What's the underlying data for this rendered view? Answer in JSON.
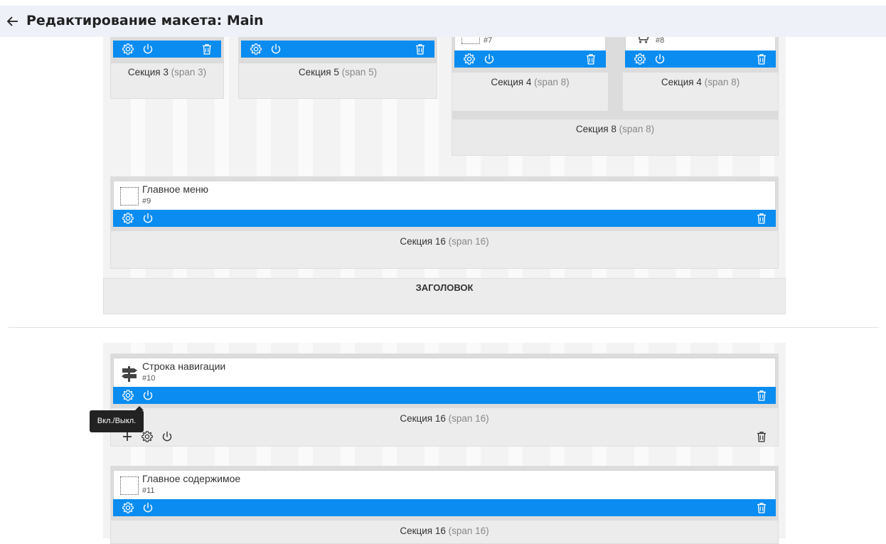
{
  "header": {
    "title": "Редактирование макета: Main"
  },
  "section_word": "Секция",
  "layout_top": {
    "sections": [
      {
        "name": "Секция 3",
        "span": "(span 3)"
      },
      {
        "name": "Секция 5",
        "span": "(span 5)"
      },
      {
        "name": "Секция 4",
        "span": "(span 8)"
      },
      {
        "name": "Секция 4",
        "span": "(span 8)"
      },
      {
        "name": "Секция 8",
        "span": "(span 8)"
      }
    ],
    "modules": [
      {
        "number": "#7",
        "icon": "placeholder-icon"
      },
      {
        "number": "#8",
        "icon": "cart-icon"
      }
    ],
    "menu_row": {
      "module": {
        "title": "Главное меню",
        "number": "#9",
        "icon": "placeholder-icon"
      },
      "section": {
        "name": "Секция 16",
        "span": "(span 16)"
      }
    },
    "header_label": "ЗАГОЛОВОК"
  },
  "layout_bottom": {
    "nav_row": {
      "module": {
        "title": "Строка навигации",
        "number": "#10",
        "icon": "signpost-icon"
      },
      "section": {
        "name": "Секция 16",
        "span": "(span 16)"
      }
    },
    "content_row": {
      "module": {
        "title": "Главное содержимое",
        "number": "#11",
        "icon": "placeholder-icon"
      },
      "section": {
        "name": "Секция 16",
        "span": "(span 16)"
      }
    }
  },
  "tooltip": {
    "text": "Вкл./Выкл."
  },
  "colors": {
    "accent_blue": "#0a8cf0",
    "topbar_bg": "#eef1f8"
  }
}
